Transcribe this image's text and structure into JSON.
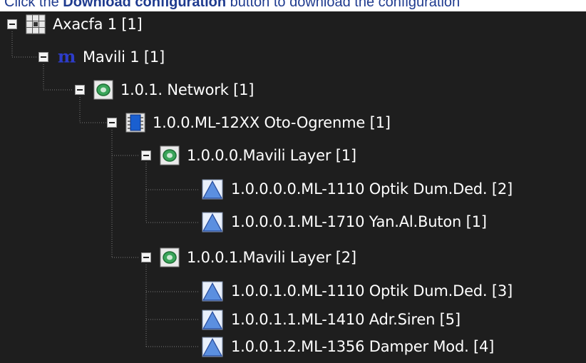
{
  "instruction": {
    "before": "Click the ",
    "bold": "Download configuration",
    "after": " button to download the configuration"
  },
  "tree": {
    "nodes": [
      {
        "label": "Axacfa 1 [1]",
        "icon": "panel-grid-icon",
        "expanded": true
      },
      {
        "label": "Mavili 1 [1]",
        "icon": "mavili-logo-icon",
        "expanded": true
      },
      {
        "label": "1.0.1. Network [1]",
        "icon": "network-icon",
        "expanded": true
      },
      {
        "label": "1.0.0.ML-12XX Oto-Ogrenme [1]",
        "icon": "chip-icon",
        "expanded": true
      },
      {
        "label": "1.0.0.0.Mavili Layer [1]",
        "icon": "network-icon",
        "expanded": true
      },
      {
        "label": "1.0.0.0.0.ML-1110 Optik Dum.Ded. [2]",
        "icon": "device-triangle-icon"
      },
      {
        "label": "1.0.0.0.1.ML-1710 Yan.Al.Buton [1]",
        "icon": "device-triangle-icon"
      },
      {
        "label": "1.0.0.1.Mavili Layer [2]",
        "icon": "network-icon",
        "expanded": true
      },
      {
        "label": "1.0.0.1.0.ML-1110 Optik Dum.Ded. [3]",
        "icon": "device-triangle-icon"
      },
      {
        "label": "1.0.0.1.1.ML-1410 Adr.Siren [5]",
        "icon": "device-triangle-icon"
      },
      {
        "label": "1.0.0.1.2.ML-1356 Damper Mod. [4]",
        "icon": "device-triangle-icon"
      }
    ]
  },
  "colors": {
    "background": "#1e1e1e",
    "text": "#ffffff",
    "instruction_text": "#1f3b8f"
  }
}
